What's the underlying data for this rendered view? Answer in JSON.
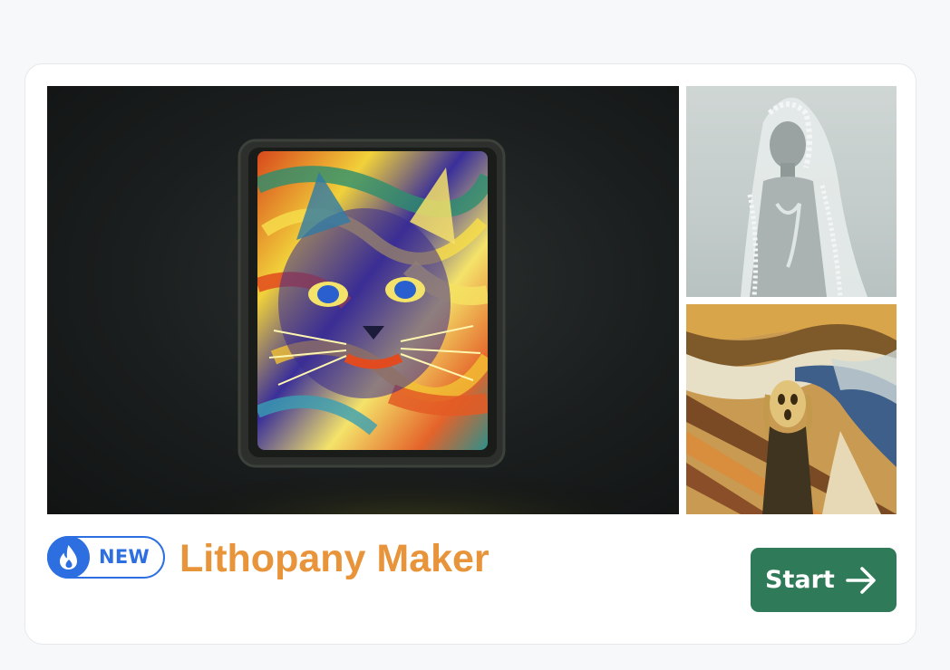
{
  "card": {
    "badge": {
      "label": "NEW",
      "icon": "flame-drop-icon",
      "color": "#2d6fe0"
    },
    "title": "Lithopany Maker",
    "title_color": "#e8943a",
    "start_button": {
      "label": "Start",
      "icon": "arrow-right-icon",
      "color": "#2f7a59"
    },
    "images": {
      "main": "lithophane-cat-lightbox",
      "side_top": "lithophane-veiled-woman",
      "side_bottom": "lithophane-the-scream"
    }
  }
}
